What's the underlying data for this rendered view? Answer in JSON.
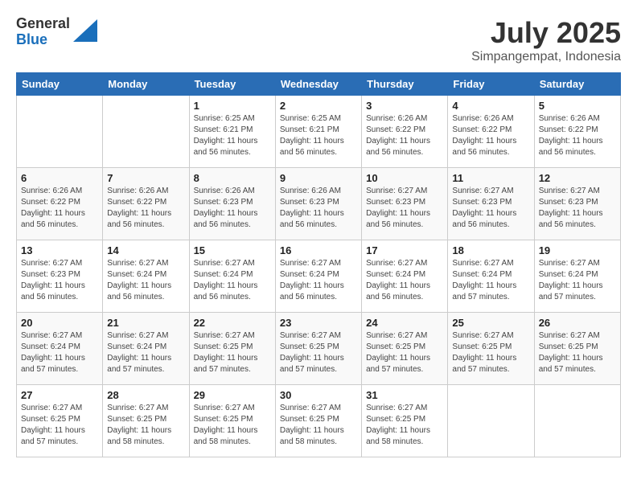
{
  "header": {
    "logo": {
      "general": "General",
      "blue": "Blue"
    },
    "title": "July 2025",
    "subtitle": "Simpangempat, Indonesia"
  },
  "weekdays": [
    "Sunday",
    "Monday",
    "Tuesday",
    "Wednesday",
    "Thursday",
    "Friday",
    "Saturday"
  ],
  "weeks": [
    [
      {
        "day": "",
        "info": ""
      },
      {
        "day": "",
        "info": ""
      },
      {
        "day": "1",
        "info": "Sunrise: 6:25 AM\nSunset: 6:21 PM\nDaylight: 11 hours and 56 minutes."
      },
      {
        "day": "2",
        "info": "Sunrise: 6:25 AM\nSunset: 6:21 PM\nDaylight: 11 hours and 56 minutes."
      },
      {
        "day": "3",
        "info": "Sunrise: 6:26 AM\nSunset: 6:22 PM\nDaylight: 11 hours and 56 minutes."
      },
      {
        "day": "4",
        "info": "Sunrise: 6:26 AM\nSunset: 6:22 PM\nDaylight: 11 hours and 56 minutes."
      },
      {
        "day": "5",
        "info": "Sunrise: 6:26 AM\nSunset: 6:22 PM\nDaylight: 11 hours and 56 minutes."
      }
    ],
    [
      {
        "day": "6",
        "info": "Sunrise: 6:26 AM\nSunset: 6:22 PM\nDaylight: 11 hours and 56 minutes."
      },
      {
        "day": "7",
        "info": "Sunrise: 6:26 AM\nSunset: 6:22 PM\nDaylight: 11 hours and 56 minutes."
      },
      {
        "day": "8",
        "info": "Sunrise: 6:26 AM\nSunset: 6:23 PM\nDaylight: 11 hours and 56 minutes."
      },
      {
        "day": "9",
        "info": "Sunrise: 6:26 AM\nSunset: 6:23 PM\nDaylight: 11 hours and 56 minutes."
      },
      {
        "day": "10",
        "info": "Sunrise: 6:27 AM\nSunset: 6:23 PM\nDaylight: 11 hours and 56 minutes."
      },
      {
        "day": "11",
        "info": "Sunrise: 6:27 AM\nSunset: 6:23 PM\nDaylight: 11 hours and 56 minutes."
      },
      {
        "day": "12",
        "info": "Sunrise: 6:27 AM\nSunset: 6:23 PM\nDaylight: 11 hours and 56 minutes."
      }
    ],
    [
      {
        "day": "13",
        "info": "Sunrise: 6:27 AM\nSunset: 6:23 PM\nDaylight: 11 hours and 56 minutes."
      },
      {
        "day": "14",
        "info": "Sunrise: 6:27 AM\nSunset: 6:24 PM\nDaylight: 11 hours and 56 minutes."
      },
      {
        "day": "15",
        "info": "Sunrise: 6:27 AM\nSunset: 6:24 PM\nDaylight: 11 hours and 56 minutes."
      },
      {
        "day": "16",
        "info": "Sunrise: 6:27 AM\nSunset: 6:24 PM\nDaylight: 11 hours and 56 minutes."
      },
      {
        "day": "17",
        "info": "Sunrise: 6:27 AM\nSunset: 6:24 PM\nDaylight: 11 hours and 56 minutes."
      },
      {
        "day": "18",
        "info": "Sunrise: 6:27 AM\nSunset: 6:24 PM\nDaylight: 11 hours and 57 minutes."
      },
      {
        "day": "19",
        "info": "Sunrise: 6:27 AM\nSunset: 6:24 PM\nDaylight: 11 hours and 57 minutes."
      }
    ],
    [
      {
        "day": "20",
        "info": "Sunrise: 6:27 AM\nSunset: 6:24 PM\nDaylight: 11 hours and 57 minutes."
      },
      {
        "day": "21",
        "info": "Sunrise: 6:27 AM\nSunset: 6:24 PM\nDaylight: 11 hours and 57 minutes."
      },
      {
        "day": "22",
        "info": "Sunrise: 6:27 AM\nSunset: 6:25 PM\nDaylight: 11 hours and 57 minutes."
      },
      {
        "day": "23",
        "info": "Sunrise: 6:27 AM\nSunset: 6:25 PM\nDaylight: 11 hours and 57 minutes."
      },
      {
        "day": "24",
        "info": "Sunrise: 6:27 AM\nSunset: 6:25 PM\nDaylight: 11 hours and 57 minutes."
      },
      {
        "day": "25",
        "info": "Sunrise: 6:27 AM\nSunset: 6:25 PM\nDaylight: 11 hours and 57 minutes."
      },
      {
        "day": "26",
        "info": "Sunrise: 6:27 AM\nSunset: 6:25 PM\nDaylight: 11 hours and 57 minutes."
      }
    ],
    [
      {
        "day": "27",
        "info": "Sunrise: 6:27 AM\nSunset: 6:25 PM\nDaylight: 11 hours and 57 minutes."
      },
      {
        "day": "28",
        "info": "Sunrise: 6:27 AM\nSunset: 6:25 PM\nDaylight: 11 hours and 58 minutes."
      },
      {
        "day": "29",
        "info": "Sunrise: 6:27 AM\nSunset: 6:25 PM\nDaylight: 11 hours and 58 minutes."
      },
      {
        "day": "30",
        "info": "Sunrise: 6:27 AM\nSunset: 6:25 PM\nDaylight: 11 hours and 58 minutes."
      },
      {
        "day": "31",
        "info": "Sunrise: 6:27 AM\nSunset: 6:25 PM\nDaylight: 11 hours and 58 minutes."
      },
      {
        "day": "",
        "info": ""
      },
      {
        "day": "",
        "info": ""
      }
    ]
  ]
}
